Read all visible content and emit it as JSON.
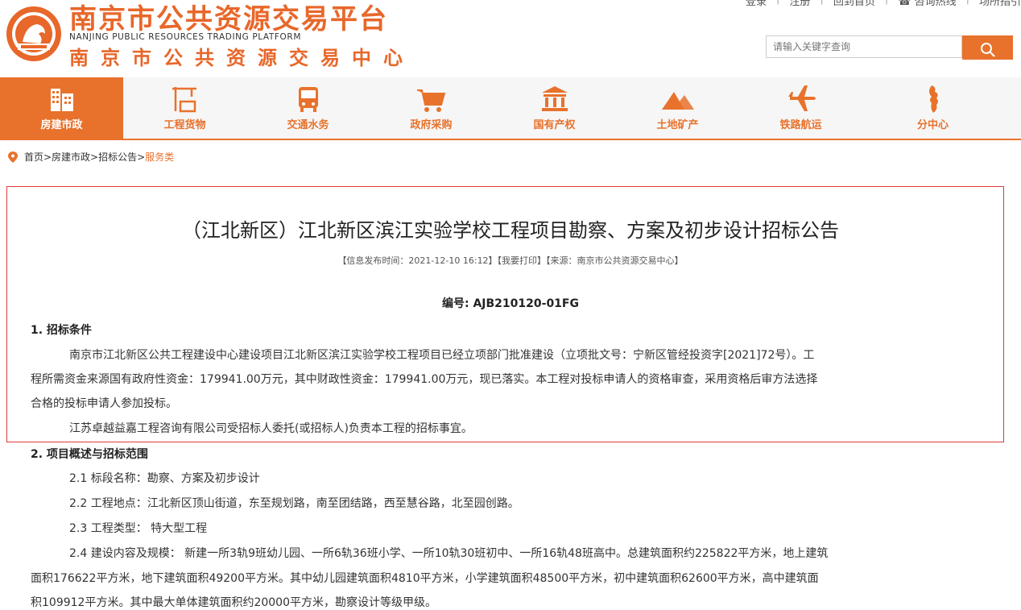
{
  "header": {
    "logo_cn_large": "南京市公共资源交易平台",
    "logo_en": "NANJING PUBLIC RESOURCES TRADING PLATFORM",
    "logo_cn_small": "南京市公共资源交易中心",
    "top_links": [
      "登录",
      "注册",
      "回到首页",
      "咨询热线",
      "场所指引"
    ],
    "search_placeholder": "请输入关键字查询"
  },
  "nav": {
    "items": [
      {
        "label": "房建市政",
        "icon": "building-icon",
        "active": true
      },
      {
        "label": "工程货物",
        "icon": "crane-icon"
      },
      {
        "label": "交通水务",
        "icon": "bus-icon"
      },
      {
        "label": "政府采购",
        "icon": "cart-icon"
      },
      {
        "label": "国有产权",
        "icon": "bank-icon"
      },
      {
        "label": "土地矿产",
        "icon": "mountain-icon"
      },
      {
        "label": "铁路航运",
        "icon": "airplane-icon"
      },
      {
        "label": "分中心",
        "icon": "map-icon"
      }
    ]
  },
  "breadcrumb": {
    "path": "首页>房建市政>招标公告>",
    "current": "服务类"
  },
  "article": {
    "title": "（江北新区）江北新区滨江实验学校工程项目勘察、方案及初步设计招标公告",
    "meta": "【信息发布时间：2021-12-10 16:12】【我要打印】【来源：南京市公共资源交易中心】",
    "code": "编号: AJB210120-01FG",
    "sec1_title": "1. 招标条件",
    "sec1_p1_l1": "南京市江北新区公共工程建设中心建设项目江北新区滨江实验学校工程项目已经立项部门批准建设（立项批文号：宁新区管经投资字[2021]72号）。工",
    "sec1_p1_l2": "程所需资金来源国有政府性资金：179941.00万元，其中财政性资金：179941.00万元，现已落实。本工程对投标申请人的资格审查，采用资格后审方法选择",
    "sec1_p1_l3": "合格的投标申请人参加投标。",
    "sec1_p2": "江苏卓越益嘉工程咨询有限公司受招标人委托(或招标人)负责本工程的招标事宜。",
    "sec2_title": "2. 项目概述与招标范围",
    "sec2_1": "2.1 标段名称：勘察、方案及初步设计",
    "sec2_2": "2.2 工程地点：江北新区顶山街道，东至规划路，南至团结路，西至慧谷路，北至园创路。",
    "sec2_3": "2.3 工程类型： 特大型工程",
    "sec2_4_l1": "2.4 建设内容及规模： 新建一所3轨9班幼儿园、一所6轨36班小学、一所10轨30班初中、一所16轨48班高中。总建筑面积约225822平方米，地上建筑",
    "sec2_4_l2": "面积176622平方米，地下建筑面积49200平方米。其中幼儿园建筑面积4810平方米，小学建筑面积48500平方米，初中建筑面积62600平方米，高中建筑面",
    "sec2_4_l3": "积109912平方米。其中最大单体建筑面积约20000平方米，勘察设计等级甲级。"
  },
  "colors": {
    "accent": "#e8722c",
    "highlight_border": "#e03a3a"
  }
}
